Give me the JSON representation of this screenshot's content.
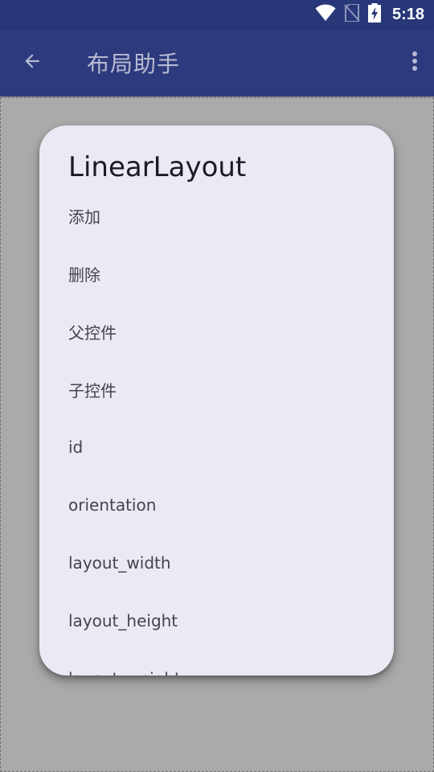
{
  "status_bar": {
    "time": "5:18",
    "icons": [
      "wifi-icon",
      "no-sim-icon",
      "battery-charging-icon"
    ]
  },
  "app_bar": {
    "title": "布局助手",
    "back_icon": "arrow-back-icon",
    "overflow_icon": "more-vert-icon"
  },
  "menu": {
    "title": "LinearLayout",
    "items": [
      {
        "label": "添加"
      },
      {
        "label": "删除"
      },
      {
        "label": "父控件"
      },
      {
        "label": "子控件"
      },
      {
        "label": "id"
      },
      {
        "label": "orientation"
      },
      {
        "label": "layout_width"
      },
      {
        "label": "layout_height"
      },
      {
        "label": "layout_weight"
      }
    ]
  },
  "colors": {
    "app_bar": "#2e3a7e",
    "status_bar": "#283778",
    "canvas_background": "#aaaaaa",
    "menu_background": "#ece8f4"
  }
}
